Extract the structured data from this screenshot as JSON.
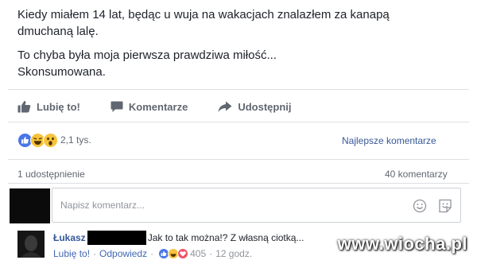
{
  "post": {
    "line1": "Kiedy miałem 14 lat, będąc u wuja na wakacjach znalazłem za kanapą",
    "line2": "dmuchaną lalę.",
    "line3": "To chyba była moja pierwsza prawdziwa miłość...",
    "line4": "Skonsumowana."
  },
  "actions": {
    "like": "Lubię to!",
    "comment": "Komentarze",
    "share": "Udostępnij"
  },
  "reactions": {
    "count": "2,1 tys.",
    "icons": [
      "like-icon",
      "haha-icon",
      "wow-icon"
    ]
  },
  "best_comments": "Najlepsze komentarze",
  "shares": "1 udostępnienie",
  "comments_count": "40 komentarzy",
  "composer": {
    "placeholder": "Napisz komentarz...",
    "icons": [
      "emoji-icon",
      "sticker-icon"
    ]
  },
  "comment": {
    "author": "Łukasz",
    "text": "Jak to tak można!? Z własną ciotką...",
    "like": "Lubię to!",
    "reply": "Odpowiedz",
    "reactions_count": "405",
    "time": "12 godz."
  },
  "watermark": "www.wiocha.pl",
  "colors": {
    "link": "#4267b2",
    "text": "#1d2129",
    "muted": "#90949c",
    "divider": "#dddfe2",
    "like_blue": "#4a76e8",
    "haha_yellow": "#f7c33c",
    "love_red": "#f25268"
  }
}
